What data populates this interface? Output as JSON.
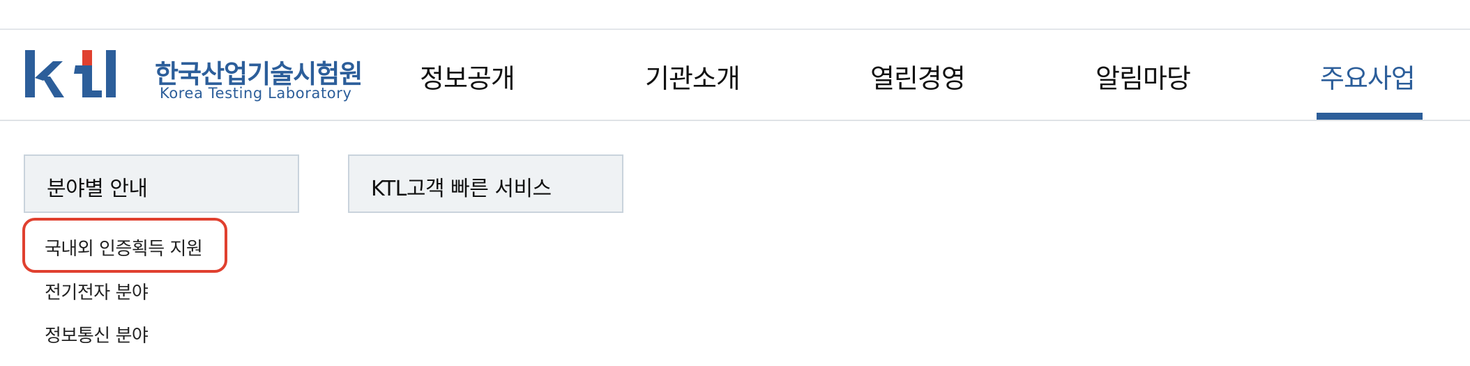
{
  "logo": {
    "mark_text": "ktl",
    "name_kr": "한국산업기술시험원",
    "name_en": "Korea Testing Laboratory"
  },
  "nav": {
    "items": [
      {
        "label": "정보공개"
      },
      {
        "label": "기관소개"
      },
      {
        "label": "열린경영"
      },
      {
        "label": "알림마당"
      },
      {
        "label": "주요사업",
        "active": true
      }
    ]
  },
  "menu": {
    "categories": [
      {
        "label": "분야별 안내"
      },
      {
        "label": "KTL고객 빠른 서비스"
      }
    ],
    "sub_items": [
      {
        "label": "국내외 인증획득 지원",
        "highlighted": true
      },
      {
        "label": "전기전자 분야"
      },
      {
        "label": "정보통신 분야"
      }
    ]
  },
  "colors": {
    "brand_blue": "#2c5e9a",
    "logo_red": "#e0402f",
    "highlight_red": "#e0402f",
    "box_bg": "#eff2f4"
  }
}
